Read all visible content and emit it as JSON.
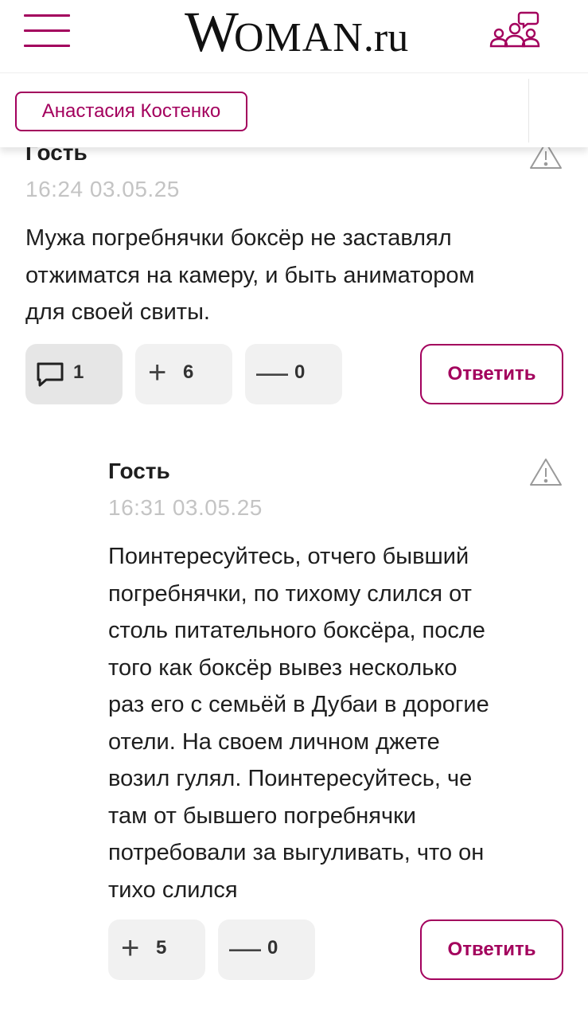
{
  "header": {
    "logo_w": "W",
    "logo_oman": "OMAN",
    "logo_ru": ".ru",
    "menu_icon": "hamburger-icon",
    "community_icon": "people-icon"
  },
  "author_bar": {
    "chip_label": "Анастасия Костенко"
  },
  "colors": {
    "accent": "#a3005d",
    "muted_text": "#c4c4c4",
    "pill_bg": "#f1f1f1"
  },
  "comments": [
    {
      "author": "Гость",
      "time": "16:24 03.05.25",
      "text_lines": [
        "Мужа погребнячки боксёр не заставлял",
        "отжиматся на камеру, и быть аниматором",
        "для своей свиты."
      ],
      "replies_count": "1",
      "plus_symbol": "+",
      "plus_count": "6",
      "minus_symbol": "—",
      "minus_count": "0",
      "reply_label": "Ответить"
    },
    {
      "author": "Гость",
      "time": "16:31 03.05.25",
      "text_lines": [
        "Поинтересуйтесь, отчего бывший",
        "погребнячки, по тихому слился от",
        "столь питательного боксёра, после",
        "того как боксёр вывез несколько",
        "раз его с семьёй в Дубаи в дорогие",
        "отели. На своем личном джете",
        "возил гулял. Поинтересуйтесь, че",
        "там от бывшего погребнячки",
        "потребовали за выгуливать, что он",
        "тихо слился"
      ],
      "plus_symbol": "+",
      "plus_count": "5",
      "minus_symbol": "—",
      "minus_count": "0",
      "reply_label": "Ответить"
    }
  ]
}
